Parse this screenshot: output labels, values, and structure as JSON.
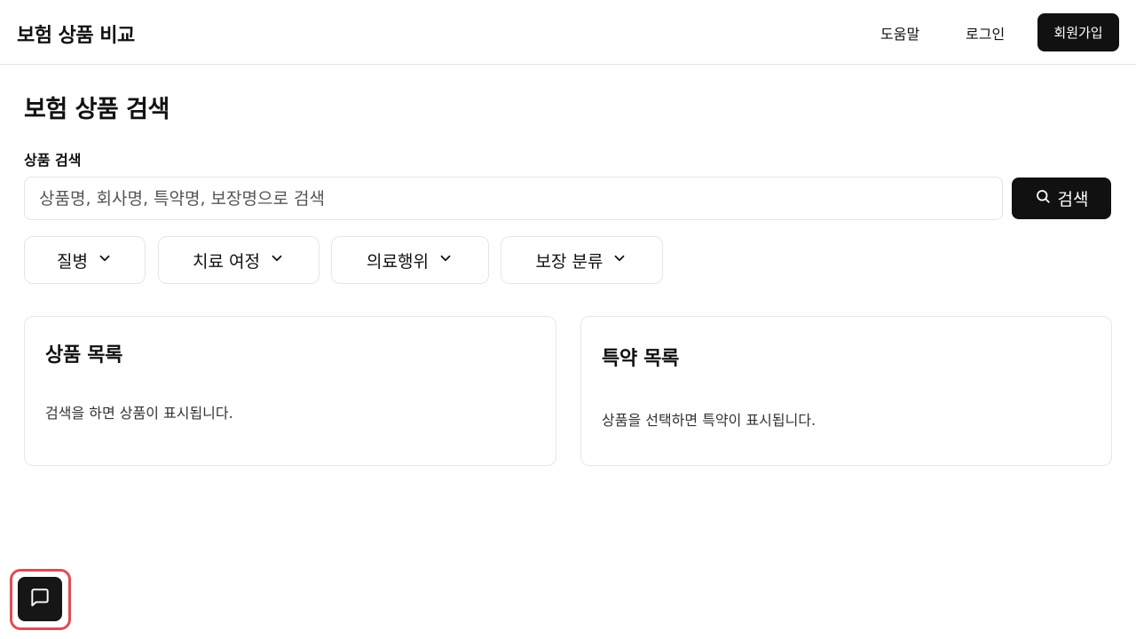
{
  "header": {
    "brand": "보험 상품 비교",
    "help_label": "도움말",
    "login_label": "로그인",
    "signup_label": "회원가입"
  },
  "main": {
    "title": "보험 상품 검색",
    "search": {
      "label": "상품 검색",
      "placeholder": "상품명, 회사명, 특약명, 보장명으로 검색",
      "value": "",
      "button_label": "검색",
      "button_icon": "search-icon"
    },
    "filters": [
      {
        "label": "질병",
        "icon": "chevron-down-icon"
      },
      {
        "label": "치료 여정",
        "icon": "chevron-down-icon"
      },
      {
        "label": "의료행위",
        "icon": "chevron-down-icon"
      },
      {
        "label": "보장 분류",
        "icon": "chevron-down-icon"
      }
    ],
    "product_list": {
      "title": "상품 목록",
      "empty_text": "검색을 하면 상품이 표시됩니다."
    },
    "rider_list": {
      "title": "특약 목록",
      "empty_text": "상품을 선택하면 특약이 표시됩니다."
    }
  },
  "chat": {
    "icon": "chat-bubble-icon",
    "highlight_color": "#e04b55"
  },
  "colors": {
    "primary": "#111111",
    "border": "#e5e7eb",
    "background": "#ffffff"
  }
}
